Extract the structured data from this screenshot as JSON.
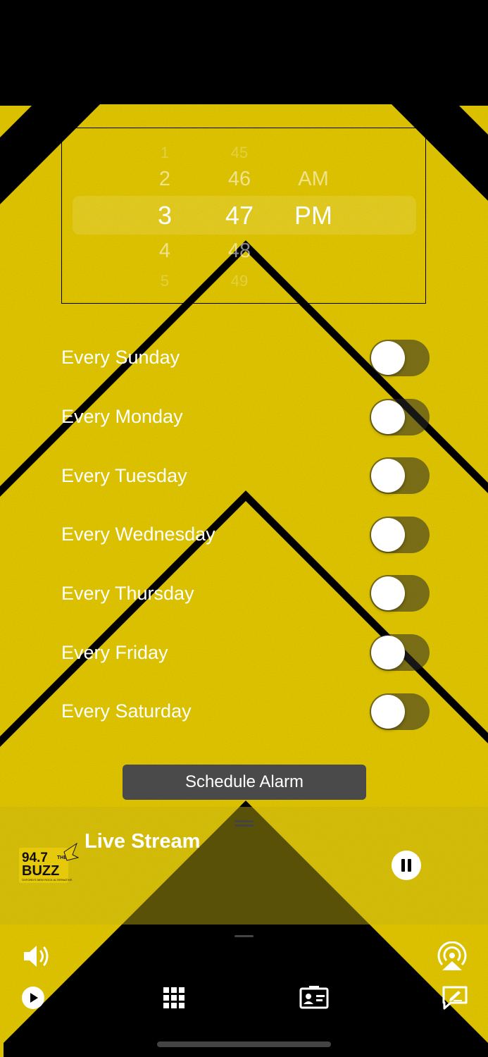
{
  "time_picker": {
    "hours": [
      "1",
      "2",
      "3",
      "4",
      "5"
    ],
    "minutes": [
      "45",
      "46",
      "47",
      "48",
      "49"
    ],
    "periods": [
      "AM",
      "PM"
    ],
    "selected": {
      "hour": "3",
      "minute": "47",
      "period": "PM"
    }
  },
  "days": [
    {
      "label": "Every Sunday",
      "enabled": false
    },
    {
      "label": "Every Monday",
      "enabled": false
    },
    {
      "label": "Every Tuesday",
      "enabled": false
    },
    {
      "label": "Every Wednesday",
      "enabled": false
    },
    {
      "label": "Every Thursday",
      "enabled": false
    },
    {
      "label": "Every Friday",
      "enabled": false
    },
    {
      "label": "Every Saturday",
      "enabled": false
    }
  ],
  "schedule_button": {
    "label": "Schedule Alarm"
  },
  "player": {
    "title": "Live Stream",
    "logo": {
      "line1": "94.7",
      "line2": "BUZZ",
      "badge": "THE",
      "tagline": "OXFORD'S NEW ROCK ALTERNATIVE"
    },
    "state_icon": "pause-icon"
  },
  "bottom_bar": {
    "icons": [
      "volume-icon",
      "airplay-icon",
      "play-icon",
      "grid-icon",
      "contact-card-icon",
      "message-icon"
    ]
  },
  "colors": {
    "stripe_yellow": "#E7C90C",
    "background": "#000000",
    "button": "#4A4A4A"
  }
}
